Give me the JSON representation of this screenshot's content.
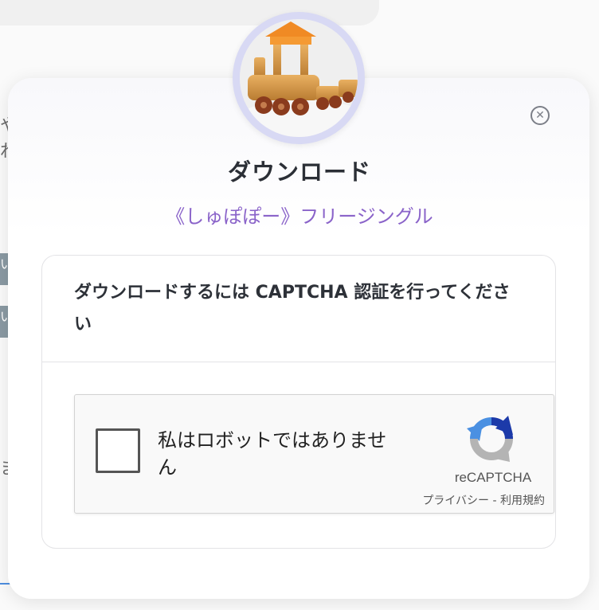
{
  "dialog": {
    "title": "ダウンロード",
    "subtitle": "《しゅぽぽー》フリージングル",
    "close_symbol": "✕",
    "thumbnail_icon": "toy-train-image"
  },
  "captcha_card": {
    "heading": "ダウンロードするには CAPTCHA 認証を行ってください"
  },
  "recaptcha": {
    "checkbox_label": "私はロボットではありません",
    "brand": "reCAPTCHA",
    "privacy_link": "プライバシー",
    "separator": " - ",
    "terms_link": "利用規約",
    "checked": false
  },
  "background": {
    "fragments": [
      "や",
      "わ",
      "い",
      "い",
      "ま"
    ]
  },
  "colors": {
    "subtitle": "#8a63c9",
    "avatar_ring": "#d8d9f4",
    "recaptcha_blue": "#4a90e2",
    "recaptcha_navy": "#1c3aa9",
    "recaptcha_gray": "#b4b4b4"
  }
}
